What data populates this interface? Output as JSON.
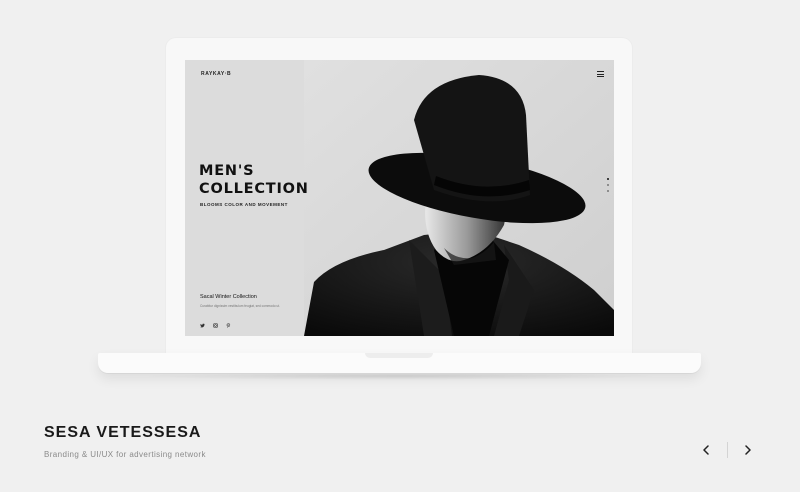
{
  "mockup": {
    "site": {
      "logo": "RAYKAY·B",
      "hero_title": "MEN'S\nCOLLECTION",
      "hero_subtitle": "BLOOMS COLOR AND MOVEMENT",
      "collection_title": "Sacal Winter Collection",
      "collection_desc": "Curabitur dignissim vestibulum feugiat, sed commodo ut.",
      "social_icons": [
        "twitter-icon",
        "instagram-icon",
        "pinterest-icon"
      ],
      "menu_icon": "hamburger-menu-icon"
    }
  },
  "project": {
    "title": "SESA VETESSESA",
    "subtitle": "Branding & UI/UX for advertising network"
  },
  "nav": {
    "prev_icon": "chevron-left-icon",
    "next_icon": "chevron-right-icon"
  },
  "colors": {
    "background": "#f0f0f0",
    "text_dark": "#1a1a1a",
    "text_muted": "#8a8a8a"
  }
}
